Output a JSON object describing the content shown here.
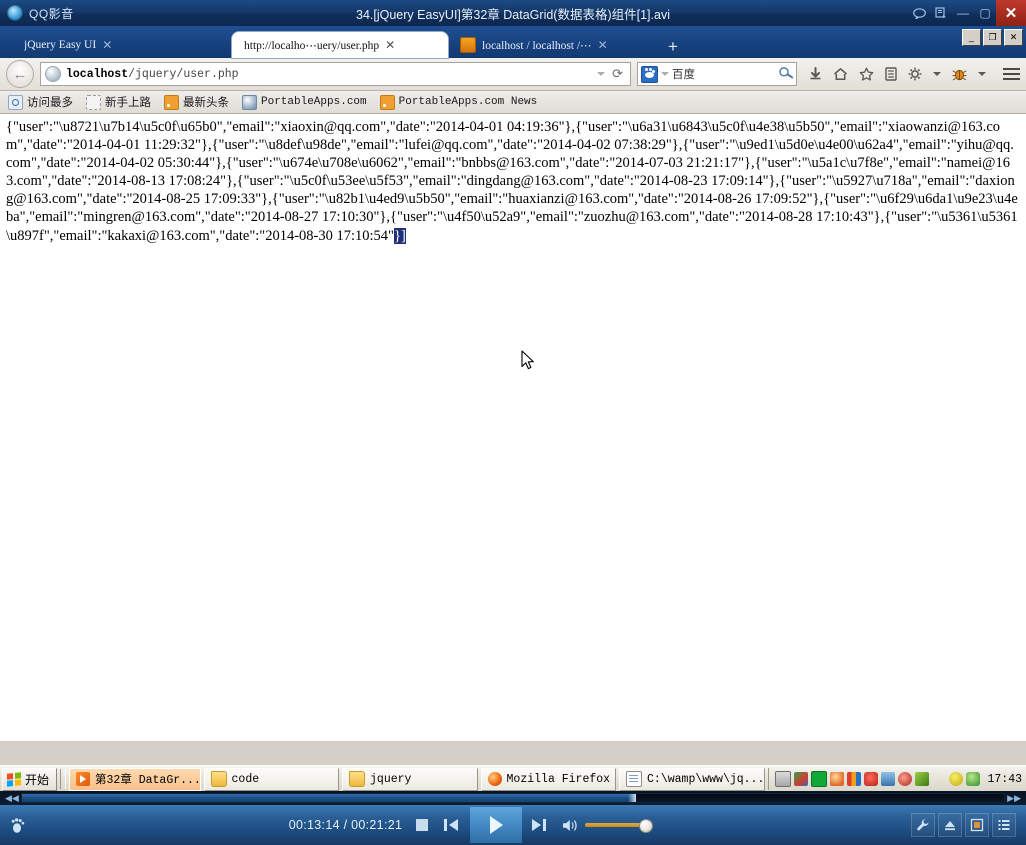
{
  "player": {
    "app_name": "QQ影音",
    "title": "34.[jQuery EasyUI]第32章 DataGrid(数据表格)组件[1].avi",
    "titlebar_icons": [
      "comment-icon",
      "screenshot-icon",
      "minimize-icon",
      "maximize-icon",
      "close-icon"
    ],
    "close_label": "✕",
    "minimize_label": "—",
    "maximize_label": "▢",
    "current_time": "00:13:14",
    "total_time": "00:21:21",
    "time_display": "00:13:14 / 00:21:21",
    "progress_percent": 62.5,
    "volume_percent": 100,
    "controls": {
      "stop": "stop-button",
      "previous": "previous-button",
      "play": "play-button",
      "next": "next-button",
      "volume": "volume-slider",
      "seek": "seek-slider"
    },
    "right_tools": [
      "wrench-icon",
      "eject-icon",
      "screenshot-icon",
      "playlist-icon"
    ]
  },
  "browser": {
    "window_buttons": {
      "minimize": "_",
      "restore": "❐",
      "close": "✕"
    },
    "tabs": [
      {
        "label": "jQuery Easy UI",
        "active": false,
        "favicon": "none",
        "close": "✕"
      },
      {
        "label": "http://localho⋯uery/user.php",
        "active": true,
        "favicon": "none",
        "close": "✕"
      },
      {
        "label": "localhost / localhost /⋯",
        "active": false,
        "favicon": "phpmyadmin-icon",
        "close": "✕"
      }
    ],
    "new_tab_label": "+",
    "back_label": "←",
    "address": {
      "host": "localhost",
      "path": "/jquery/user.php"
    },
    "reload_label": "⟳",
    "search": {
      "engine": "百度",
      "engine_icon": "baidu-paw-icon"
    },
    "toolbar_icons": [
      "download-icon",
      "home-icon",
      "bookmark-star-icon",
      "library-icon",
      "settings-gear-icon",
      "dropdown-caret-icon",
      "firebug-icon",
      "dropdown-caret-icon",
      "hamburger-menu-icon"
    ],
    "bookmarks": [
      {
        "label": "访问最多",
        "icon": "most-visited-icon",
        "mono": false
      },
      {
        "label": "新手上路",
        "icon": "getting-started-icon",
        "mono": false
      },
      {
        "label": "最新头条",
        "icon": "rss-icon",
        "mono": false
      },
      {
        "label": "PortableApps.com",
        "icon": "portableapps-icon",
        "mono": true
      },
      {
        "label": "PortableApps.com News",
        "icon": "rss-icon",
        "mono": true
      }
    ],
    "page_content": {
      "before_selection": "{\"user\":\"\\u8721\\u7b14\\u5c0f\\u65b0\",\"email\":\"xiaoxin@qq.com\",\"date\":\"2014-04-01 04:19:36\"},{\"user\":\"\\u6a31\\u6843\\u5c0f\\u4e38\\u5b50\",\"email\":\"xiaowanzi@163.com\",\"date\":\"2014-04-01 11:29:32\"},{\"user\":\"\\u8def\\u98de\",\"email\":\"lufei@qq.com\",\"date\":\"2014-04-02 07:38:29\"},{\"user\":\"\\u9ed1\\u5d0e\\u4e00\\u62a4\",\"email\":\"yihu@qq.com\",\"date\":\"2014-04-02 05:30:44\"},{\"user\":\"\\u674e\\u708e\\u6062\",\"email\":\"bnbbs@163.com\",\"date\":\"2014-07-03 21:21:17\"},{\"user\":\"\\u5a1c\\u7f8e\",\"email\":\"namei@163.com\",\"date\":\"2014-08-13 17:08:24\"},{\"user\":\"\\u5c0f\\u53ee\\u5f53\",\"email\":\"dingdang@163.com\",\"date\":\"2014-08-23 17:09:14\"},{\"user\":\"\\u5927\\u718a\",\"email\":\"daxiong@163.com\",\"date\":\"2014-08-25 17:09:33\"},{\"user\":\"\\u82b1\\u4ed9\\u5b50\",\"email\":\"huaxianzi@163.com\",\"date\":\"2014-08-26 17:09:52\"},{\"user\":\"\\u6f29\\u6da1\\u9e23\\u4eba\",\"email\":\"mingren@163.com\",\"date\":\"2014-08-27 17:10:30\"},{\"user\":\"\\u4f50\\u52a9\",\"email\":\"zuozhu@163.com\",\"date\":\"2014-08-28 17:10:43\"},{\"user\":\"\\u5361\\u5361\\u897f\",\"email\":\"kakaxi@163.com\",\"date\":\"2014-08-30 17:10:54\"",
      "selection": "}]"
    }
  },
  "taskbar": {
    "start_label": "开始",
    "items": [
      {
        "label": "第32章 DataGr...",
        "icon": "avi-file-icon",
        "active": true
      },
      {
        "label": "code",
        "icon": "folder-icon",
        "active": false
      },
      {
        "label": "jquery",
        "icon": "folder-icon",
        "active": false
      },
      {
        "label": "Mozilla Firefox",
        "icon": "firefox-icon",
        "active": false
      },
      {
        "label": "C:\\wamp\\www\\jq...",
        "icon": "notepad-icon",
        "active": false
      }
    ],
    "tray_icons": [
      "keyboard-icon",
      "ime-icon",
      "wamp-icon",
      "qq-icon",
      "chart-icon",
      "shield-icon",
      "network-icon",
      "sound-icon",
      "scan-icon",
      "sogou-icon",
      "update-icon",
      "security-icon"
    ],
    "clock": "17:43"
  }
}
